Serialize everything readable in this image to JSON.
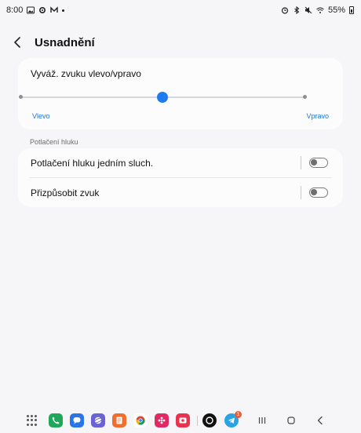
{
  "status_bar": {
    "time": "8:00",
    "battery": "55%",
    "left_icons": [
      "image-icon",
      "gear-icon",
      "m-icon",
      "dot"
    ],
    "right_icons": [
      "alarm-icon",
      "bluetooth-icon",
      "mute-icon",
      "wifi-icon",
      "battery-icon"
    ]
  },
  "header": {
    "title": "Usnadnění",
    "back_icon": "back-icon"
  },
  "balance": {
    "title": "Vyváž. zvuku vlevo/vpravo",
    "left_label": "Vlevo",
    "right_label": "Vpravo",
    "value": 0.5
  },
  "section": {
    "title": "Potlačení hluku"
  },
  "settings": [
    {
      "label": "Potlačení hluku jedním sluch.",
      "enabled": false
    },
    {
      "label": "Přizpůsobit zvuk",
      "enabled": false
    }
  ],
  "taskbar": {
    "apps": [
      {
        "name": "phone-icon",
        "color": "#20a85a"
      },
      {
        "name": "messages-icon",
        "color": "#2a76e8"
      },
      {
        "name": "internet-icon",
        "color": "#6a63d6"
      },
      {
        "name": "notes-icon",
        "color": "#f06f2d"
      },
      {
        "name": "chrome-icon",
        "color": "#ffffff"
      },
      {
        "name": "gallery-icon",
        "color": "#e12964"
      },
      {
        "name": "screen-recorder-icon",
        "color": "#e8334f"
      },
      {
        "name": "camera-circle-icon",
        "color": "#111111"
      },
      {
        "name": "telegram-icon",
        "color": "#2aa3e0",
        "badge": "1"
      }
    ],
    "nav": [
      "recents-icon",
      "home-icon",
      "back-nav-icon"
    ]
  },
  "colors": {
    "accent": "#1f7cf0",
    "link": "#1a74d8",
    "background": "#f6f6f8"
  }
}
